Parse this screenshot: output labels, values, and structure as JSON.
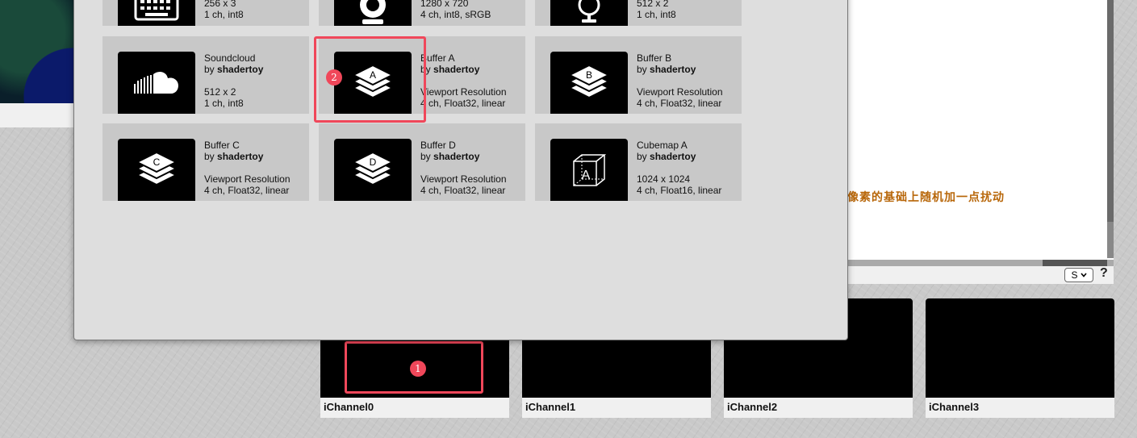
{
  "editor": {
    "comment": "像素的基础上随机加一点扰动",
    "font_select_value": "S",
    "help_label": "?"
  },
  "dialog": {
    "top_row": [
      {
        "size": "256 x 3",
        "format": "1 ch, int8"
      },
      {
        "size": "1280 x 720",
        "format": "4 ch, int8, sRGB"
      },
      {
        "size": "512 x 2",
        "format": "1 ch, int8"
      }
    ],
    "tiles": [
      {
        "name": "Soundcloud",
        "by_prefix": "by",
        "author": "shadertoy",
        "size": "512 x 2",
        "format": "1 ch, int8",
        "icon": "soundcloud-icon"
      },
      {
        "name": "Buffer A",
        "by_prefix": "by",
        "author": "shadertoy",
        "size": "Viewport Resolution",
        "format": "4 ch, Float32, linear",
        "icon": "buffer-stack-icon",
        "letter": "A"
      },
      {
        "name": "Buffer B",
        "by_prefix": "by",
        "author": "shadertoy",
        "size": "Viewport Resolution",
        "format": "4 ch, Float32, linear",
        "icon": "buffer-stack-icon",
        "letter": "B"
      },
      {
        "name": "Buffer C",
        "by_prefix": "by",
        "author": "shadertoy",
        "size": "Viewport Resolution",
        "format": "4 ch, Float32, linear",
        "icon": "buffer-stack-icon",
        "letter": "C"
      },
      {
        "name": "Buffer D",
        "by_prefix": "by",
        "author": "shadertoy",
        "size": "Viewport Resolution",
        "format": "4 ch, Float32, linear",
        "icon": "buffer-stack-icon",
        "letter": "D"
      },
      {
        "name": "Cubemap A",
        "by_prefix": "by",
        "author": "shadertoy",
        "size": "1024 x 1024",
        "format": "4 ch, Float16, linear",
        "icon": "cube-icon",
        "letter": "A"
      }
    ]
  },
  "channels": [
    {
      "label": "iChannel0"
    },
    {
      "label": "iChannel1"
    },
    {
      "label": "iChannel2"
    },
    {
      "label": "iChannel3"
    }
  ],
  "annotations": [
    {
      "number": "1"
    },
    {
      "number": "2"
    }
  ],
  "colors": {
    "annotation": "#f0475a",
    "comment": "#b8670a",
    "tile_bg": "#c8c8c8",
    "dialog_bg": "#dedede"
  }
}
